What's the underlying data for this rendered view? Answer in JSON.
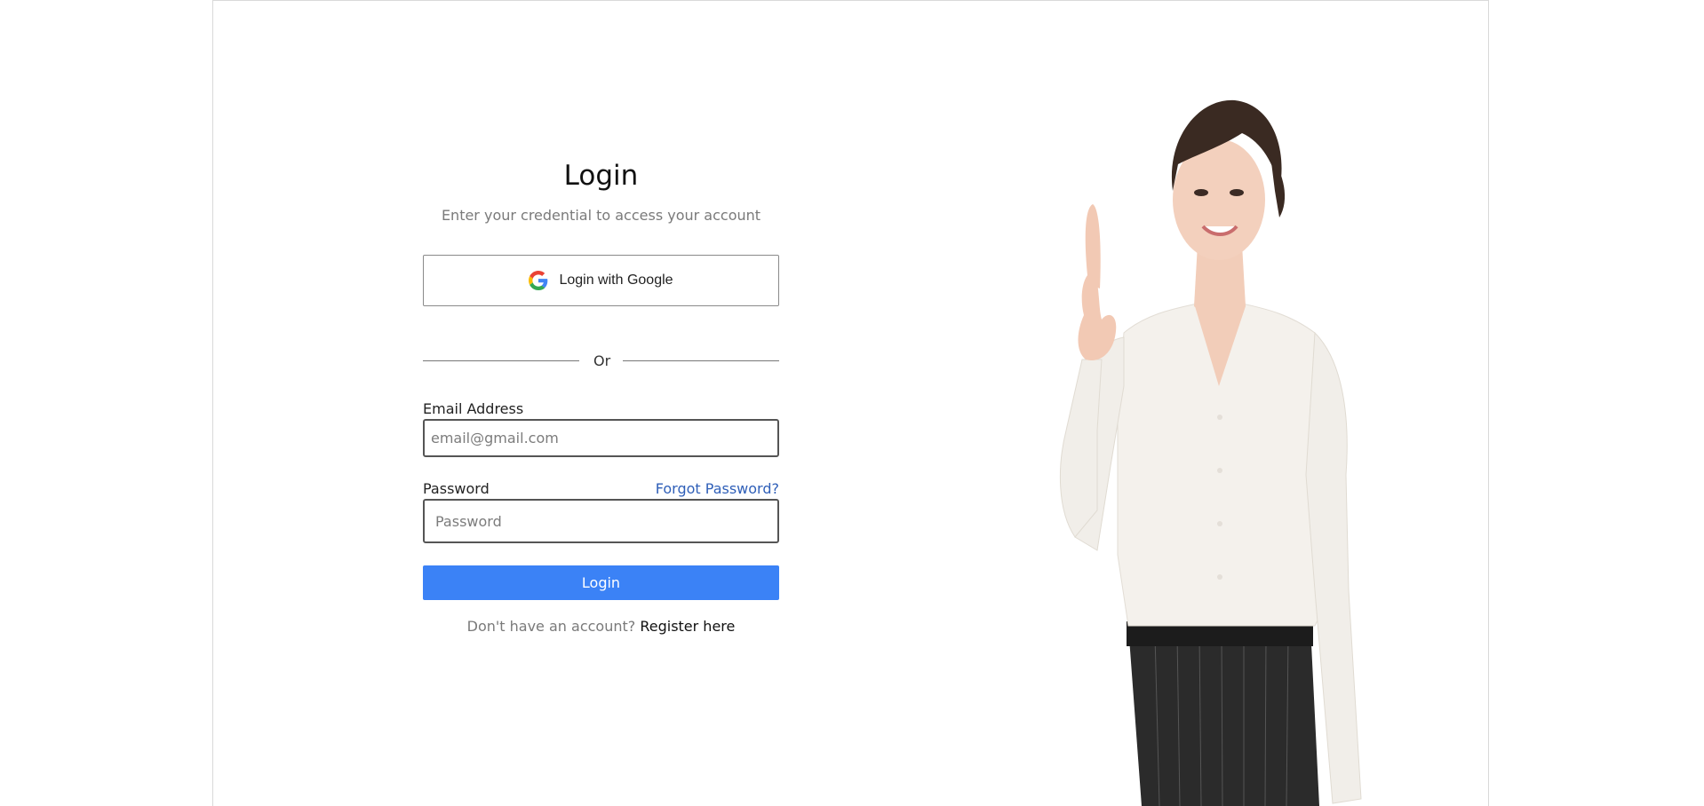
{
  "login": {
    "title": "Login",
    "subtitle": "Enter your credential to access your account",
    "google_button_label": "Login with Google",
    "divider_text": "Or",
    "email_label": "Email Address",
    "email_value": "",
    "email_placeholder": "email@gmail.com",
    "password_label": "Password",
    "forgot_password_label": "Forgot Password?",
    "password_value": "",
    "password_placeholder": "Password",
    "login_button_label": "Login",
    "register_prompt": "Don't have an account?",
    "register_link_label": "Register here"
  },
  "icons": {
    "google": "google-icon"
  },
  "colors": {
    "primary": "#3b82f6",
    "link": "#2f5fb8",
    "muted_text": "#7a7a7a",
    "background": "#ffffff"
  }
}
